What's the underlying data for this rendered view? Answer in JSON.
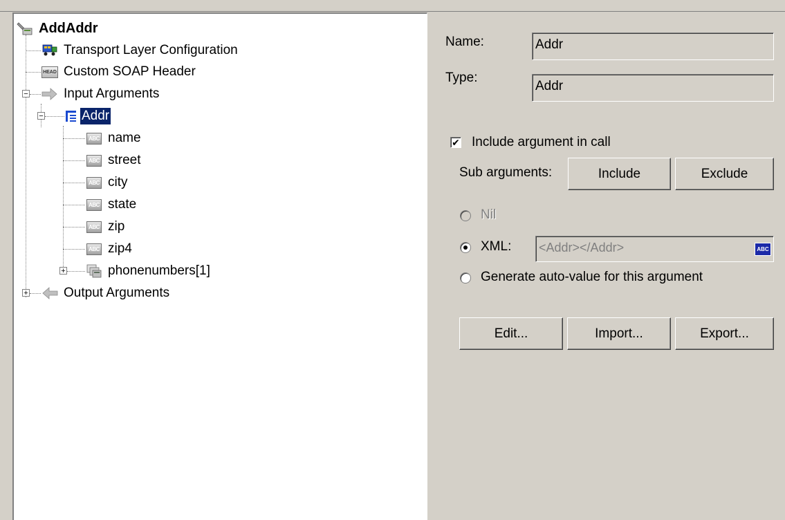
{
  "tree": {
    "root": {
      "label": "AddAddr"
    },
    "items": [
      {
        "label": "Transport Layer Configuration",
        "icon": "transport-icon"
      },
      {
        "label": "Custom SOAP Header",
        "icon": "soap-header-icon"
      },
      {
        "label": "Input Arguments",
        "icon": "input-arrow-icon"
      },
      {
        "label": "Addr",
        "icon": "struct-icon"
      },
      {
        "label": "name",
        "icon": "abc-icon"
      },
      {
        "label": "street",
        "icon": "abc-icon"
      },
      {
        "label": "city",
        "icon": "abc-icon"
      },
      {
        "label": "state",
        "icon": "abc-icon"
      },
      {
        "label": "zip",
        "icon": "abc-icon"
      },
      {
        "label": "zip4",
        "icon": "abc-icon"
      },
      {
        "label": "phonenumbers[1]",
        "icon": "array-icon"
      },
      {
        "label": "Output Arguments",
        "icon": "output-arrow-icon"
      }
    ],
    "head_icon_text": "HEAD",
    "abc_icon_text": "ABC"
  },
  "details": {
    "name_label": "Name:",
    "name_value": "Addr",
    "type_label": "Type:",
    "type_value": "Addr",
    "include_checkbox_label": "Include argument in call",
    "include_checked": true,
    "sub_arguments_label": "Sub arguments:",
    "include_button": "Include",
    "exclude_button": "Exclude",
    "nil_label": "Nil",
    "xml_label": "XML:",
    "xml_value": "<Addr></Addr>",
    "autovalue_label": "Generate auto-value for this argument",
    "abc_button_text": "ABC",
    "edit_button": "Edit...",
    "import_button": "Import...",
    "export_button": "Export..."
  },
  "colors": {
    "selection": "#0a246a",
    "window_bg": "#d4d0c8"
  }
}
